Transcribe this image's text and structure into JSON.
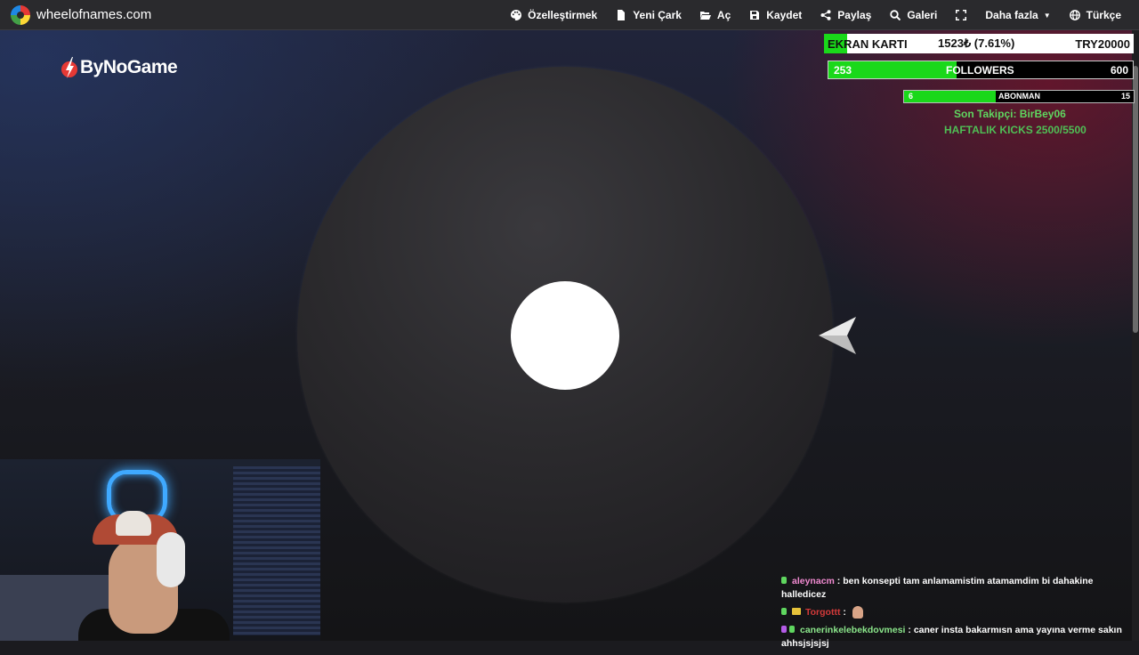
{
  "topbar": {
    "site": "wheelofnames.com",
    "nav": [
      {
        "label": "Özelleştirmek",
        "icon": "palette-icon"
      },
      {
        "label": "Yeni Çark",
        "icon": "file-icon"
      },
      {
        "label": "Aç",
        "icon": "folder-open-icon"
      },
      {
        "label": "Kaydet",
        "icon": "save-icon"
      },
      {
        "label": "Paylaş",
        "icon": "share-icon"
      },
      {
        "label": "Galeri",
        "icon": "search-icon"
      },
      {
        "label": "",
        "icon": "fullscreen-icon"
      },
      {
        "label": "Daha fazla",
        "icon": "caret-down-icon"
      },
      {
        "label": "Türkçe",
        "icon": "globe-icon"
      }
    ]
  },
  "sponsor": {
    "text": "ByNoGame"
  },
  "goals": {
    "goal1": {
      "name": "EKRAN KARTI",
      "value": "1523₺ (7.61%)",
      "target": "TRY20000",
      "progress": 0.0761,
      "fill_color": "#1ad81a"
    },
    "goal2": {
      "current": "253",
      "label": "FOLLOWERS",
      "target": "600",
      "progress": 0.4217,
      "fill_color": "#1ad81a"
    },
    "goal3": {
      "current": "6",
      "label": "ABONMAN",
      "target": "15",
      "progress": 0.4,
      "fill_color": "#1ad81a"
    },
    "last_follower": "Son Takipçi: BirBey06",
    "weekly_kicks": "HAFTALIK KICKS 2500/5500"
  },
  "chat": {
    "messages": [
      {
        "user": "aleynacm",
        "text": " : ben konsepti tam anlamamistim atamamdim bi dahakine halledicez"
      },
      {
        "user": "Torgottt",
        "text": " : "
      },
      {
        "user": "canerinkelebekdovmesi",
        "text": " : caner insta bakarmısn ama yayına verme sakın ahhsjsjsjsj"
      }
    ]
  },
  "colors": {
    "accent_green": "#1ad81a",
    "follower_text": "#5fd65f",
    "wheel": "#2b2a2d"
  }
}
